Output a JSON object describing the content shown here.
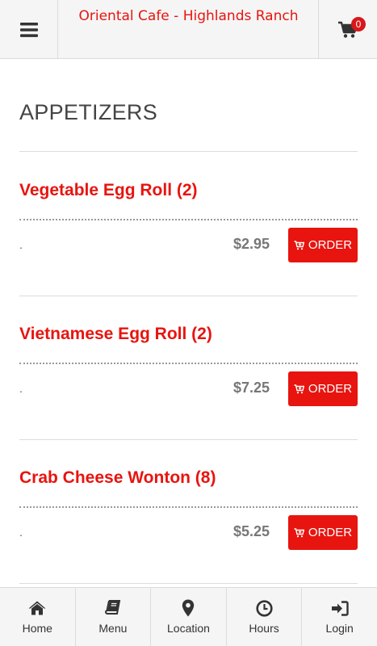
{
  "header": {
    "title": "Oriental Cafe - Highlands Ranch",
    "cart_count": "0"
  },
  "category": {
    "title": "APPETIZERS"
  },
  "items": [
    {
      "name": "Vegetable Egg Roll (2)",
      "description": ".",
      "price": "$2.95",
      "order_label": "ORDER"
    },
    {
      "name": "Vietnamese Egg Roll (2)",
      "description": ".",
      "price": "$7.25",
      "order_label": "ORDER"
    },
    {
      "name": "Crab Cheese Wonton (8)",
      "description": ".",
      "price": "$5.25",
      "order_label": "ORDER"
    }
  ],
  "bottom_nav": [
    {
      "label": "Home",
      "icon": "home-icon"
    },
    {
      "label": "Menu",
      "icon": "book-icon"
    },
    {
      "label": "Location",
      "icon": "map-marker-icon"
    },
    {
      "label": "Hours",
      "icon": "clock-icon"
    },
    {
      "label": "Login",
      "icon": "login-icon"
    }
  ],
  "colors": {
    "accent": "#e8140f",
    "badge": "#d8171a",
    "bar_background": "#f5f5f5"
  }
}
